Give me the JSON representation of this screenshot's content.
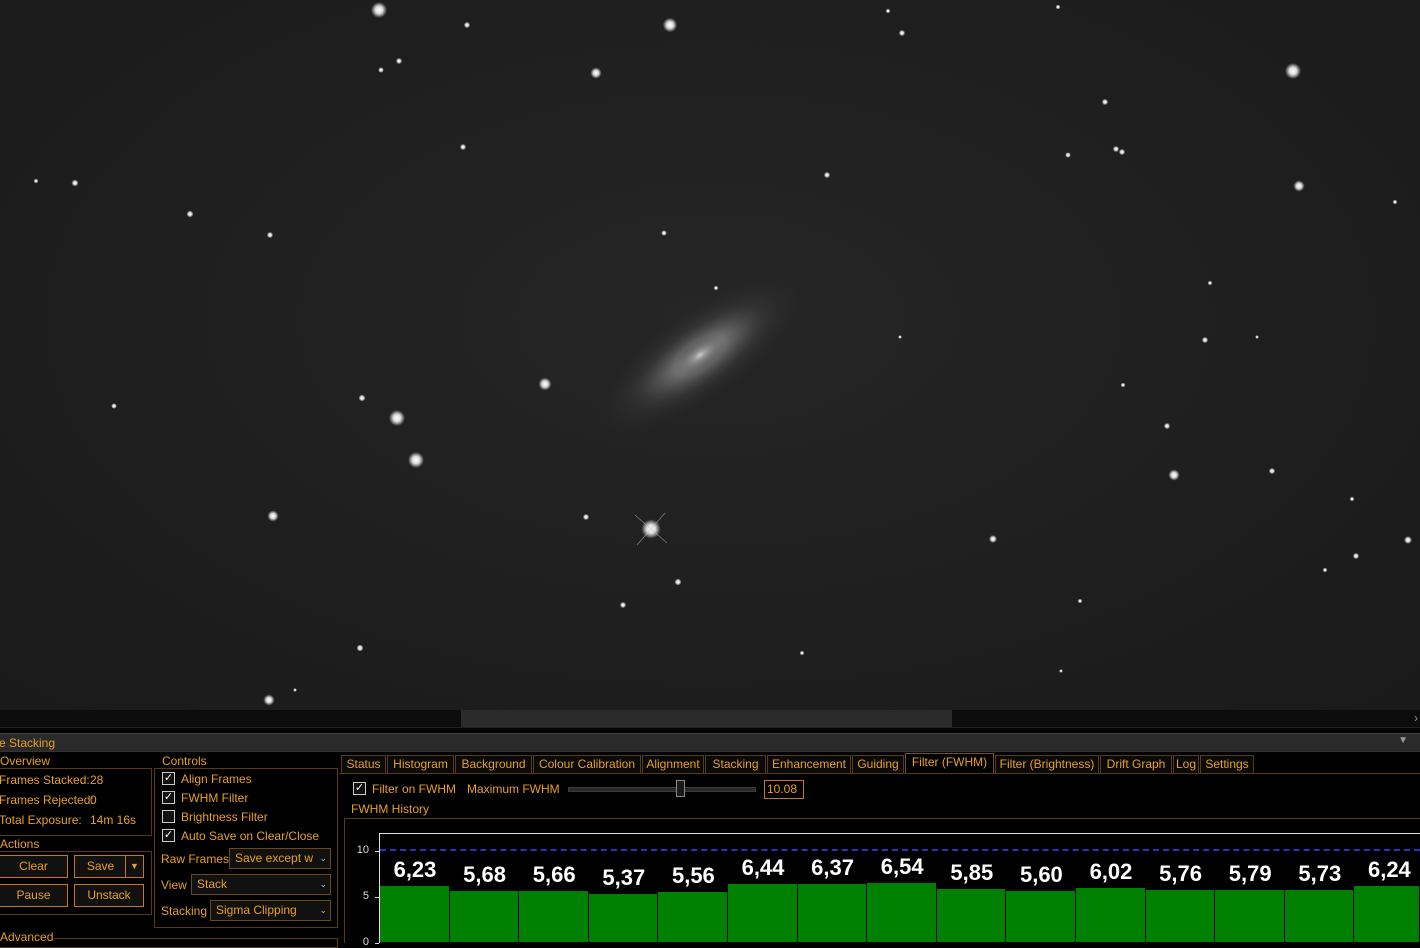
{
  "panel": {
    "title": "ve Stacking"
  },
  "overview": {
    "label": "Overview",
    "frames_stacked_label": "Frames Stacked:",
    "frames_stacked": "28",
    "frames_rejected_label": "Frames Rejected:",
    "frames_rejected": "0",
    "total_exposure_label": "Total Exposure:",
    "total_exposure": "14m 16s"
  },
  "actions": {
    "label": "Actions",
    "clear": "Clear",
    "save": "Save",
    "pause": "Pause",
    "unstack": "Unstack"
  },
  "advanced": {
    "label": "Advanced"
  },
  "controls": {
    "label": "Controls",
    "align_frames": {
      "label": "Align Frames",
      "checked": true
    },
    "fwhm_filter": {
      "label": "FWHM Filter",
      "checked": true
    },
    "brightness_filter": {
      "label": "Brightness Filter",
      "checked": false
    },
    "auto_save": {
      "label": "Auto Save on Clear/Close",
      "checked": true
    },
    "raw_frames_label": "Raw Frames",
    "raw_frames_value": "Save except w",
    "view_label": "View",
    "view_value": "Stack",
    "stacking_label": "Stacking",
    "stacking_value": "Sigma Clipping"
  },
  "tabs": [
    "Status",
    "Histogram",
    "Background",
    "Colour Calibration",
    "Alignment",
    "Stacking",
    "Enhancement",
    "Guiding",
    "Filter (FWHM)",
    "Filter (Brightness)",
    "Drift Graph",
    "Log",
    "Settings"
  ],
  "active_tab": "Filter (FWHM)",
  "filter": {
    "filter_on_fwhm_label": "Filter on FWHM",
    "filter_on_fwhm_checked": true,
    "max_fwhm_label": "Maximum FWHM",
    "max_fwhm_value": "10.08",
    "max_fwhm_slider_fraction": 0.59
  },
  "chart_data": {
    "type": "bar",
    "title": "FWHM History",
    "y_ticks": [
      "10",
      "5",
      "0"
    ],
    "ylim": [
      0,
      11.5
    ],
    "threshold": 10.08,
    "values": [
      6.23,
      5.68,
      5.66,
      5.37,
      5.56,
      6.44,
      6.37,
      6.54,
      5.85,
      5.6,
      6.02,
      5.76,
      5.79,
      5.73,
      6.24
    ],
    "labels": [
      "6,23",
      "5,68",
      "5,66",
      "5,37",
      "5,56",
      "6,44",
      "6,37",
      "6,54",
      "5,85",
      "5,60",
      "6,02",
      "5,76",
      "5,79",
      "5,73",
      "6,24"
    ],
    "colors": {
      "bar": "#008000",
      "threshold": "#3030c0"
    }
  },
  "colors": {
    "accent": "#e8a020",
    "background": "#000000"
  }
}
